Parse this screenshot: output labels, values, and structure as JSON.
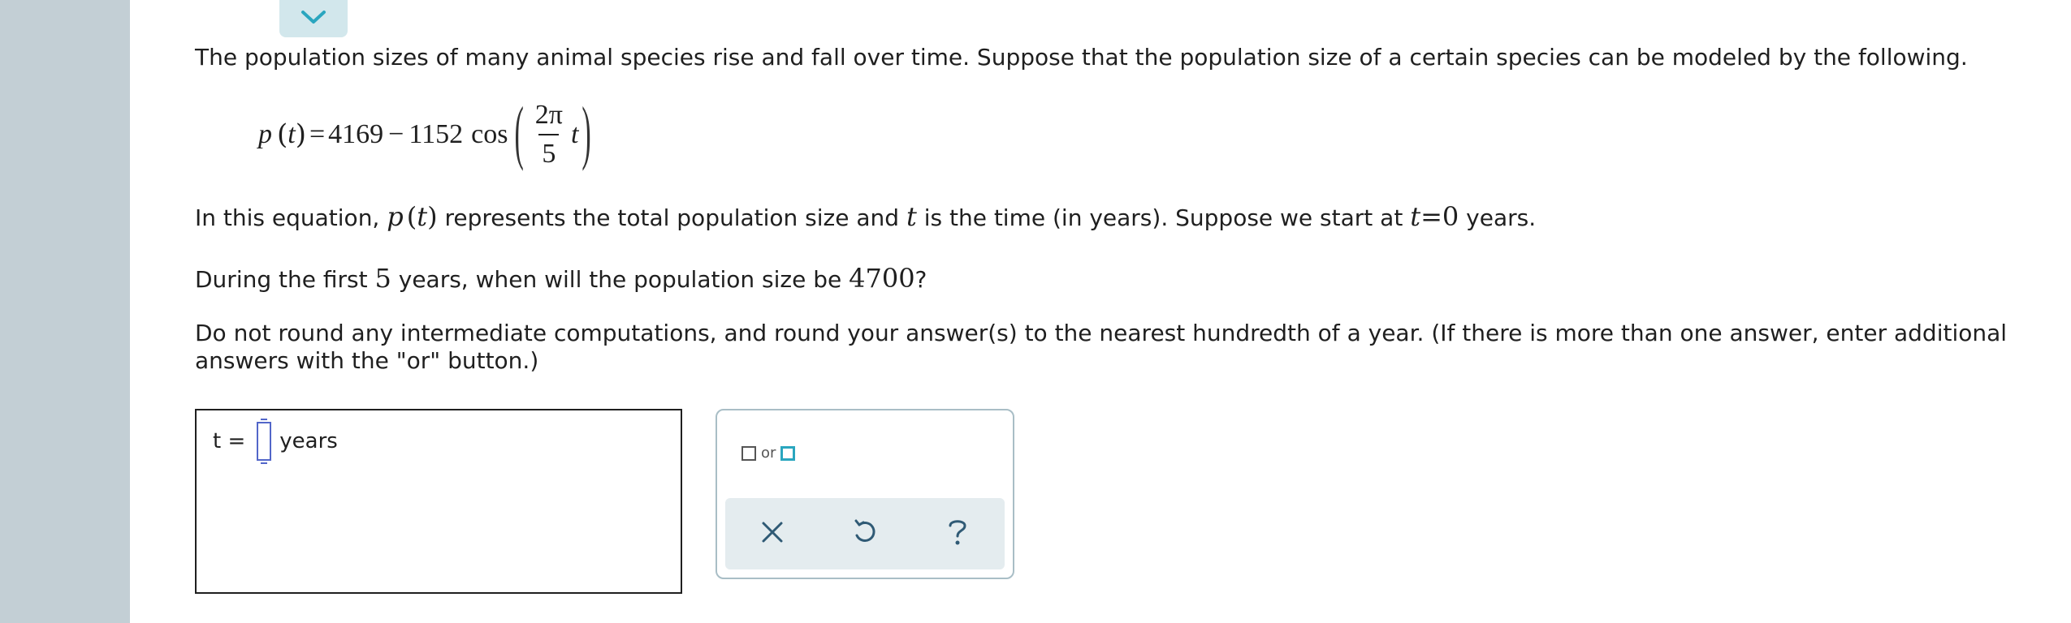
{
  "problem": {
    "intro": "The population sizes of many animal species rise and fall over time. Suppose that the population size of a certain species can be modeled by the following.",
    "equation": {
      "lhs_fn": "p",
      "lhs_var": "t",
      "equals": "=",
      "constant": "4169",
      "minus": "−",
      "coefficient": "1152",
      "func": "cos",
      "numerator": "2π",
      "denominator": "5",
      "var": "t"
    },
    "line2": {
      "prefix": "In this equation, ",
      "fn": "p",
      "var": "t",
      "mid1": " represents the total population size and ",
      "t": "t",
      "mid2": " is the time (in years). Suppose we start at ",
      "t2": "t",
      "eq": "=",
      "zero": "0",
      "suffix": " years."
    },
    "line3": {
      "prefix": "During the first ",
      "n": "5",
      "mid": " years, when will the population size be ",
      "value": "4700",
      "suffix": "?"
    },
    "instructions_1": "Do not round any intermediate computations, and round your answer(s) to the nearest hundredth of a year. (If there is more than one answer, enter additional",
    "instructions_2": "answers with the \"or\" button.)"
  },
  "answer": {
    "label": "t =",
    "value": "",
    "unit": "years"
  },
  "tools": {
    "or_label": "or",
    "clear_icon": "close-icon",
    "undo_icon": "undo-icon",
    "help_icon": "help-icon"
  },
  "colors": {
    "sidebar": "#c3cfd5",
    "accent": "#2aa6bf",
    "input_border": "#5266c9",
    "tool_bar": "#e4ecef"
  }
}
